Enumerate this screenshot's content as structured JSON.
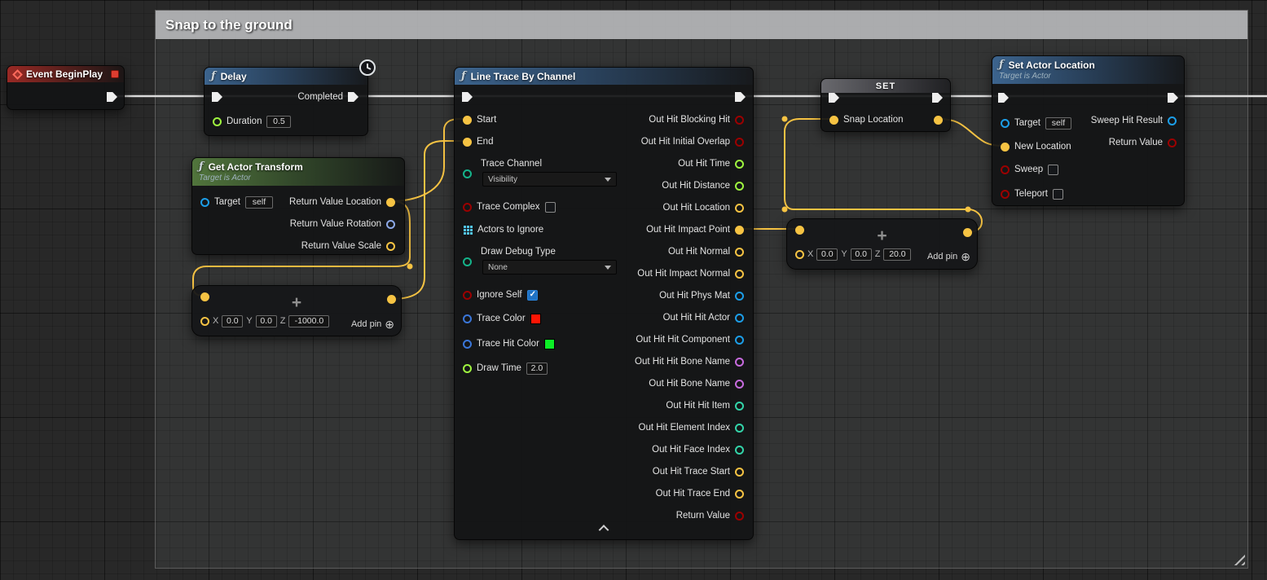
{
  "comment": {
    "title": "Snap to the ground"
  },
  "icons": {
    "function_glyph": "ƒ",
    "add_pin_glyph": "⊕",
    "plus_glyph": "+"
  },
  "pin_colors": {
    "exec": "#eeeeee",
    "bool": "#9b0000",
    "float": "#9ef43f",
    "int": "#33d4a9",
    "vector": "#f6c343",
    "rotator": "#8da9e8",
    "object": "#1c9ee8",
    "name": "#c76bde",
    "enum": "#15b38a",
    "struct": "#3a76d8"
  },
  "nodes": {
    "event_begin_play": {
      "title": "Event BeginPlay"
    },
    "delay": {
      "title": "Delay",
      "completed_label": "Completed",
      "duration_label": "Duration",
      "duration_value": "0.5"
    },
    "get_actor_transform": {
      "title": "Get Actor Transform",
      "subtitle": "Target is Actor",
      "target_label": "Target",
      "target_value": "self",
      "outputs": [
        "Return Value Location",
        "Return Value Rotation",
        "Return Value Scale"
      ]
    },
    "vector_add_1": {
      "operator": "+",
      "x_label": "X",
      "y_label": "Y",
      "z_label": "Z",
      "x_value": "0.0",
      "y_value": "0.0",
      "z_value": "-1000.0",
      "add_pin_label": "Add pin"
    },
    "line_trace": {
      "title": "Line Trace By Channel",
      "inputs": {
        "start": "Start",
        "end": "End",
        "trace_channel": "Trace Channel",
        "trace_channel_value": "Visibility",
        "trace_complex": "Trace Complex",
        "trace_complex_checked": false,
        "actors_to_ignore": "Actors to Ignore",
        "draw_debug_type": "Draw Debug Type",
        "draw_debug_type_value": "None",
        "ignore_self": "Ignore Self",
        "ignore_self_checked": true,
        "trace_color": "Trace Color",
        "trace_color_value": "#fd1504",
        "trace_hit_color": "Trace Hit Color",
        "trace_hit_color_value": "#0cef26",
        "draw_time": "Draw Time",
        "draw_time_value": "2.0"
      },
      "outputs": [
        {
          "label": "Out Hit Blocking Hit",
          "type": "bool"
        },
        {
          "label": "Out Hit Initial Overlap",
          "type": "bool"
        },
        {
          "label": "Out Hit Time",
          "type": "float"
        },
        {
          "label": "Out Hit Distance",
          "type": "float"
        },
        {
          "label": "Out Hit Location",
          "type": "vector"
        },
        {
          "label": "Out Hit Impact Point",
          "type": "vector",
          "connected": true
        },
        {
          "label": "Out Hit Normal",
          "type": "vector"
        },
        {
          "label": "Out Hit Impact Normal",
          "type": "vector"
        },
        {
          "label": "Out Hit Phys Mat",
          "type": "object"
        },
        {
          "label": "Out Hit Hit Actor",
          "type": "object"
        },
        {
          "label": "Out Hit Hit Component",
          "type": "object"
        },
        {
          "label": "Out Hit Hit Bone Name",
          "type": "name"
        },
        {
          "label": "Out Hit Bone Name",
          "type": "name"
        },
        {
          "label": "Out Hit Hit Item",
          "type": "int"
        },
        {
          "label": "Out Hit Element Index",
          "type": "int"
        },
        {
          "label": "Out Hit Face Index",
          "type": "int"
        },
        {
          "label": "Out Hit Trace Start",
          "type": "vector"
        },
        {
          "label": "Out Hit Trace End",
          "type": "vector"
        },
        {
          "label": "Return Value",
          "type": "bool"
        }
      ]
    },
    "set_snap_location": {
      "title": "SET",
      "pin_label": "Snap Location"
    },
    "vector_add_2": {
      "operator": "+",
      "x_label": "X",
      "y_label": "Y",
      "z_label": "Z",
      "x_value": "0.0",
      "y_value": "0.0",
      "z_value": "20.0",
      "add_pin_label": "Add pin"
    },
    "set_actor_location": {
      "title": "Set Actor Location",
      "subtitle": "Target is Actor",
      "target_label": "Target",
      "target_value": "self",
      "new_location_label": "New Location",
      "sweep_label": "Sweep",
      "sweep_checked": false,
      "teleport_label": "Teleport",
      "teleport_checked": false,
      "sweep_hit_result_label": "Sweep Hit Result",
      "return_value_label": "Return Value"
    }
  }
}
